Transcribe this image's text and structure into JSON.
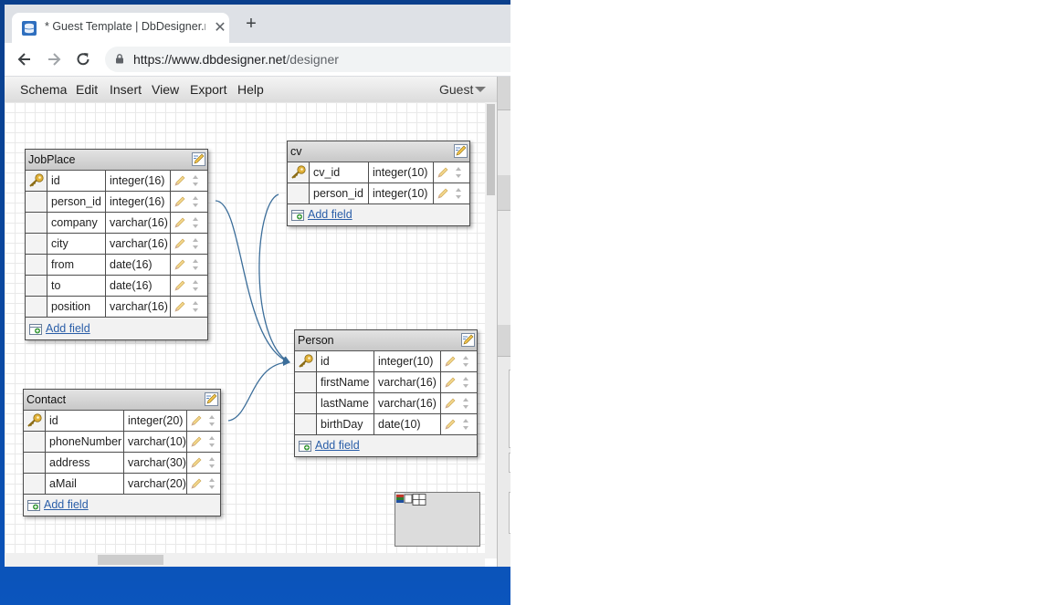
{
  "browser": {
    "tab_title": "* Guest Template | DbDesigner.net",
    "new_tab_symbol": "+",
    "close_symbol": "✕",
    "url_host": "https://www.dbdesigner.net",
    "url_path": "/designer"
  },
  "menubar": {
    "items": [
      "Schema",
      "Edit",
      "Insert",
      "View",
      "Export",
      "Help"
    ],
    "user": "Guest"
  },
  "add_field_label": "Add field",
  "tables": {
    "jobplace": {
      "name": "JobPlace",
      "fields": [
        {
          "name": "id",
          "type": "integer(16)",
          "key": true
        },
        {
          "name": "person_id",
          "type": "integer(16)",
          "key": false
        },
        {
          "name": "company",
          "type": "varchar(16)",
          "key": false
        },
        {
          "name": "city",
          "type": "varchar(16)",
          "key": false
        },
        {
          "name": "from",
          "type": "date(16)",
          "key": false
        },
        {
          "name": "to",
          "type": "date(16)",
          "key": false
        },
        {
          "name": "position",
          "type": "varchar(16)",
          "key": false
        }
      ]
    },
    "cv": {
      "name": "cv",
      "fields": [
        {
          "name": "cv_id",
          "type": "integer(10)",
          "key": true
        },
        {
          "name": "person_id",
          "type": "integer(10)",
          "key": false
        }
      ]
    },
    "person": {
      "name": "Person",
      "fields": [
        {
          "name": "id",
          "type": "integer(10)",
          "key": true
        },
        {
          "name": "firstName",
          "type": "varchar(16)",
          "key": false
        },
        {
          "name": "lastName",
          "type": "varchar(16)",
          "key": false
        },
        {
          "name": "birthDay",
          "type": "date(10)",
          "key": false
        }
      ]
    },
    "contact": {
      "name": "Contact",
      "fields": [
        {
          "name": "id",
          "type": "integer(20)",
          "key": true
        },
        {
          "name": "phoneNumber",
          "type": "varchar(10)",
          "key": false
        },
        {
          "name": "address",
          "type": "varchar(30)",
          "key": false
        },
        {
          "name": "aMail",
          "type": "varchar(20)",
          "key": false
        }
      ]
    }
  },
  "colors": {
    "link_line": "#3c6e9a",
    "accent_link": "#2a5ea8",
    "desktop": "#0b4aa4"
  }
}
